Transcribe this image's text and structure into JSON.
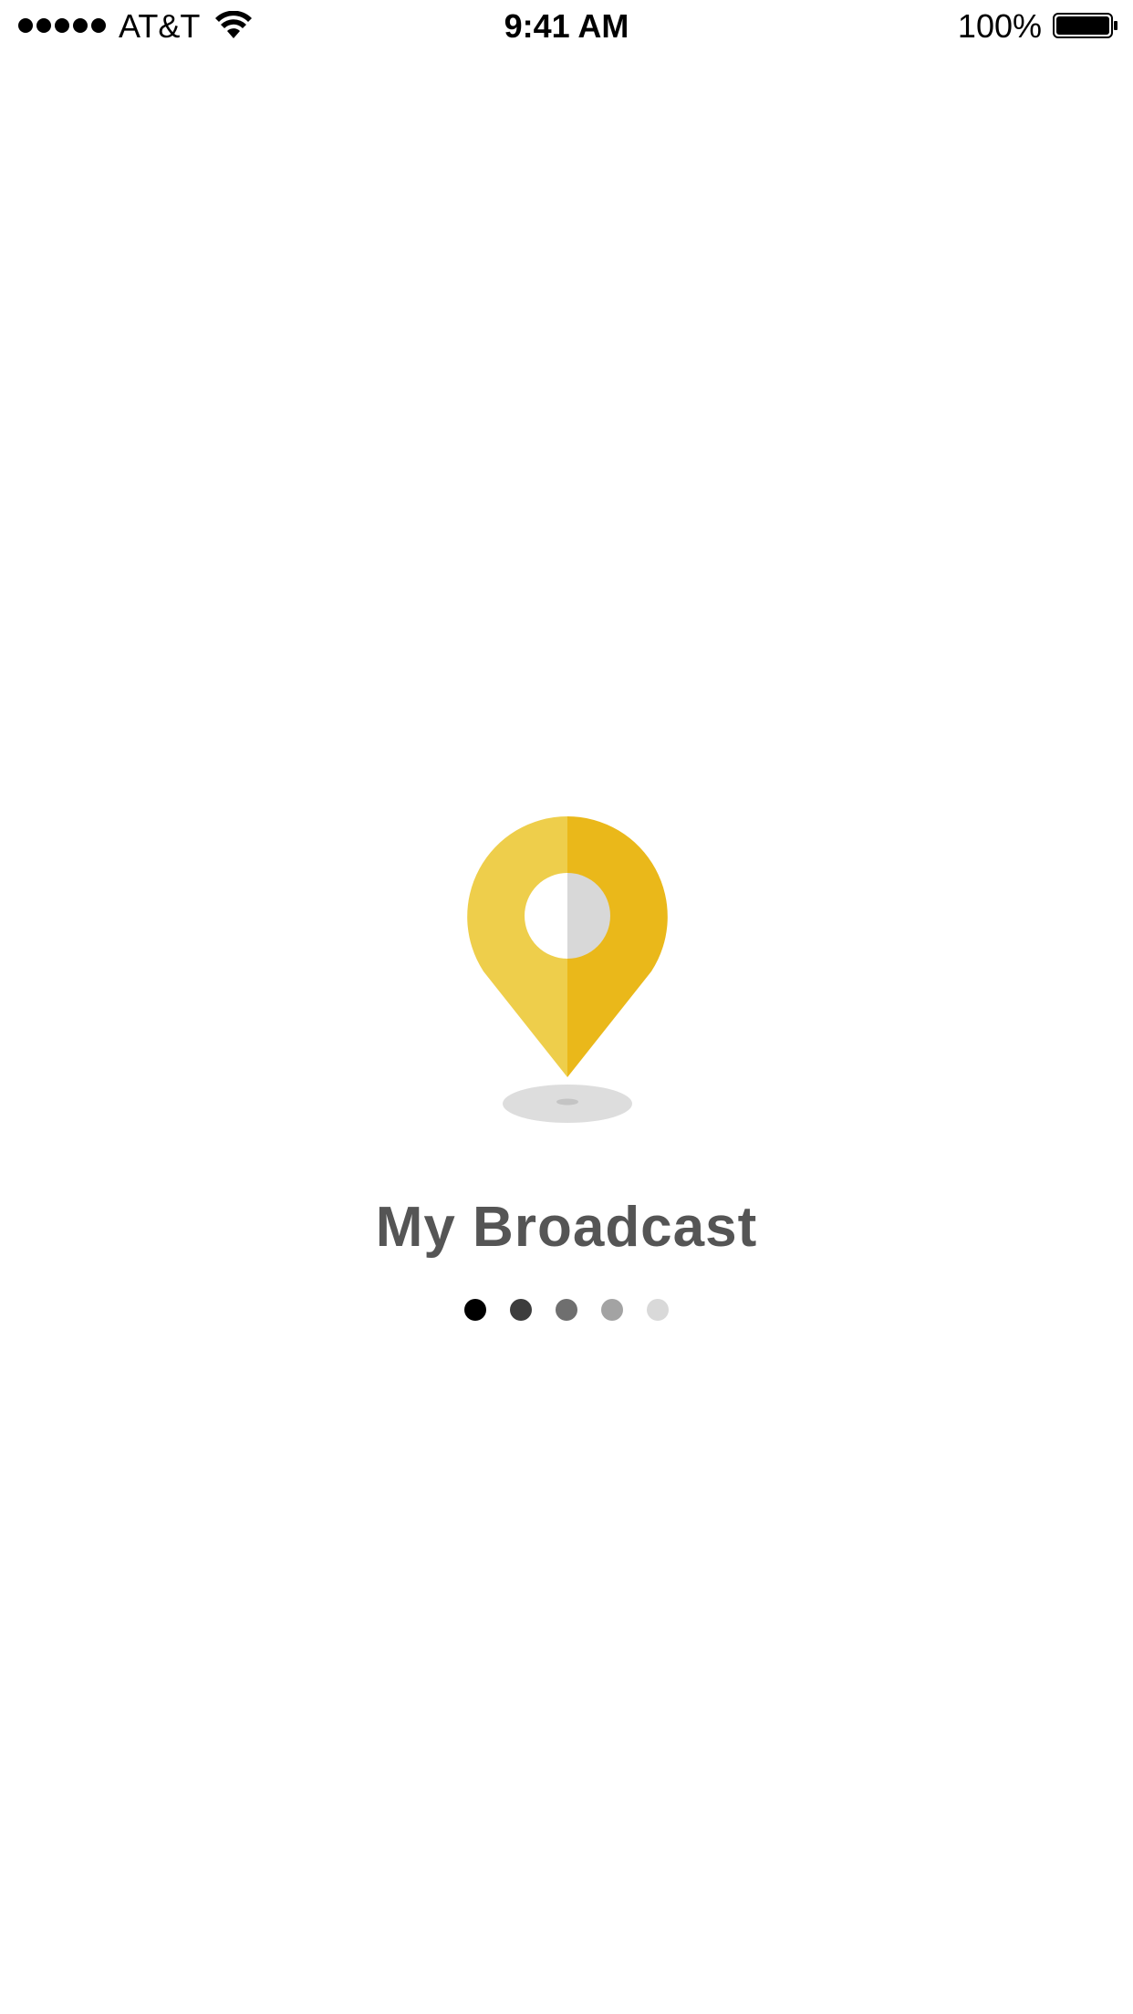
{
  "status_bar": {
    "carrier": "AT&T",
    "time": "9:41 AM",
    "battery_percent": "100%",
    "signal_icon": "signal-dots-icon",
    "wifi_icon": "wifi-icon",
    "battery_icon": "battery-icon"
  },
  "main": {
    "illustration": "location-pin-icon",
    "title": "My Broadcast",
    "page_indicator": {
      "total": 5,
      "dot_colors": [
        "#000000",
        "#3d3d3d",
        "#6f6f6f",
        "#a3a3a3",
        "#d9d9d9"
      ]
    }
  },
  "colors": {
    "pin_light": "#EECE4B",
    "pin_dark": "#EAB81A",
    "pin_hole_right": "#D8D8D8",
    "shadow": "#DDDDDD",
    "title": "#555555"
  }
}
